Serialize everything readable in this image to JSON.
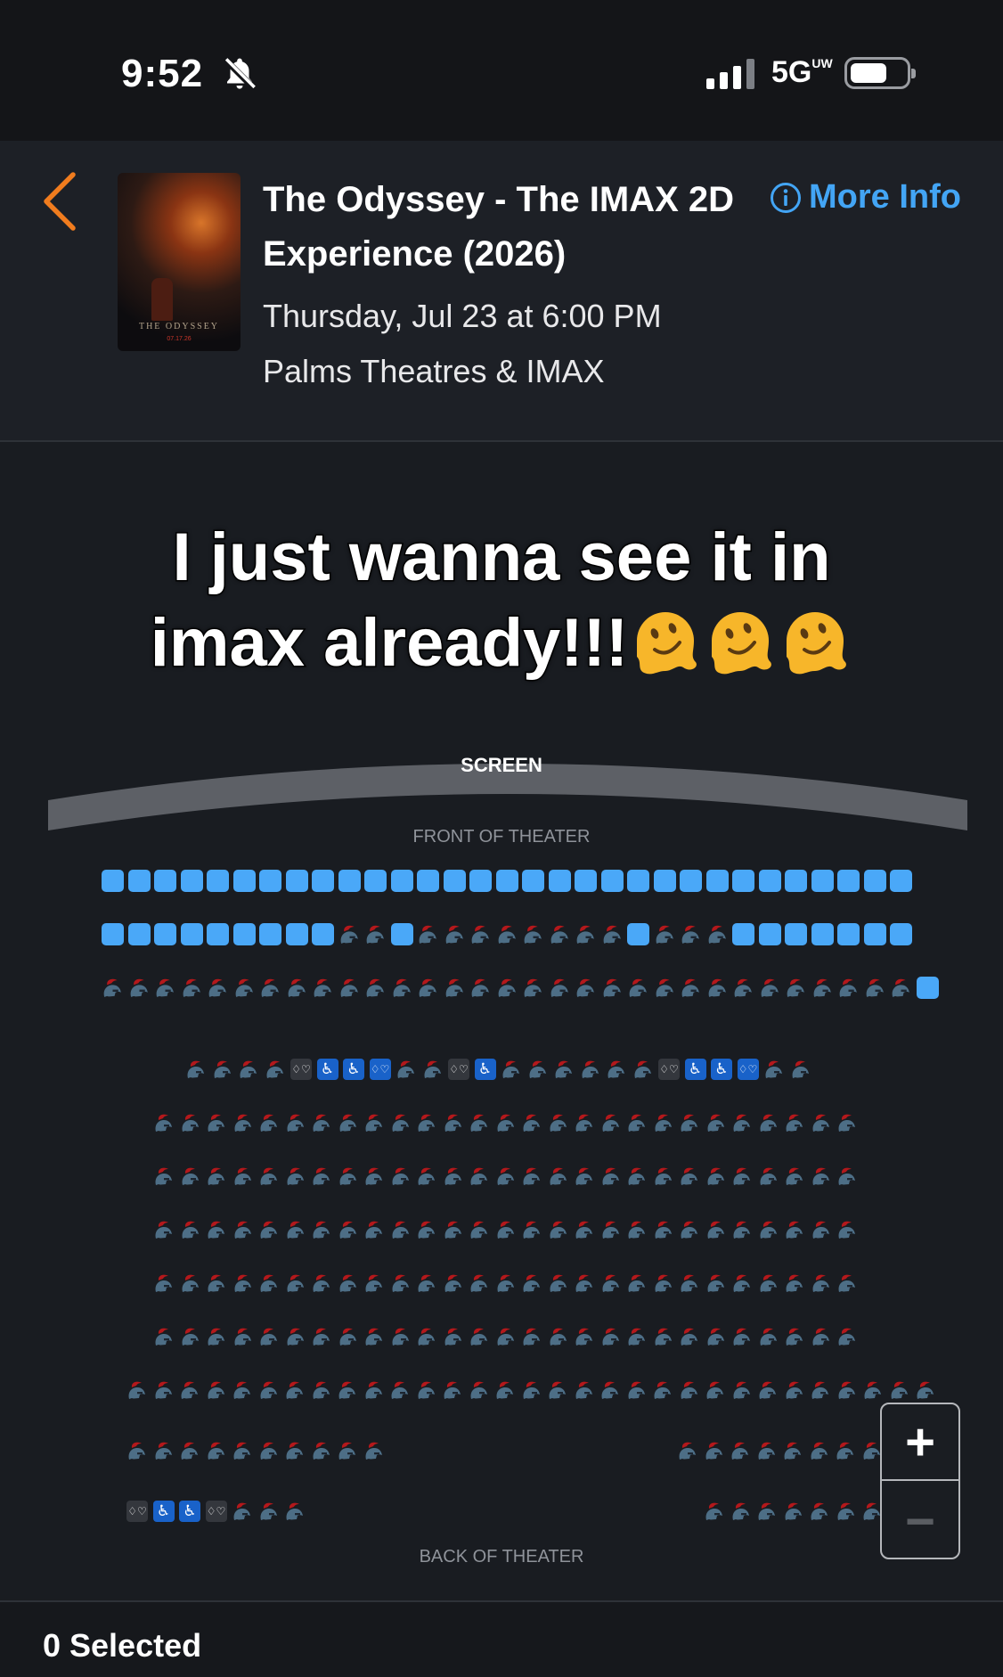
{
  "status_bar": {
    "time": "9:52",
    "network": "5G",
    "network_sup": "UW",
    "bell_icon": "bell-slash-icon"
  },
  "header": {
    "back_icon": "chevron-left-icon",
    "movie_title": "The Odyssey - The IMAX 2D Experience (2026)",
    "showtime": "Thursday, Jul 23 at 6:00 PM",
    "theatre": "Palms Theatres & IMAX",
    "more_info": "More Info",
    "poster": {
      "title": "THE ODYSSEY",
      "date": "07.17.26"
    }
  },
  "caption": {
    "line1": "I just wanna see it in",
    "line2": "imax already!!!",
    "emoji": "melting-face-icon",
    "emoji_count": 3
  },
  "seat_map": {
    "screen_label": "SCREEN",
    "front_label": "FRONT OF THEATER",
    "back_label": "BACK OF THEATER",
    "legend": {
      "a": "available",
      "t": "taken",
      "w": "wheelchair",
      "c": "companion",
      "C": "companion-accessible"
    },
    "rows": [
      "aaaaaaaaaaaaaaaaaaaaaaaaaaaaaaa",
      "aaaaaaaaattattttttttatttaaaaaaa",
      "ttttttttttttttttttttttttttttttta",
      "ttttcwwCttcwttttttcwwCtt",
      "ttttttttttttttttttttttttttt",
      "ttttttttttttttttttttttttttt",
      "ttttttttttttttttttttttttttt",
      "ttttttttttttttttttttttttttt",
      "ttttttttttttttttttttttttttt",
      "ttttttttttttttttttttttttttttttt",
      "tttttttttt|ttttttttt",
      "cwwcttt|ttttttt"
    ],
    "zoom_in": "+",
    "zoom_out": "−",
    "colors": {
      "available": "#4aa8f8",
      "wheelchair": "#1962c9",
      "companion": "#34373d",
      "helmet_plume": "#b4181b",
      "helmet_body": "#4d6e86"
    }
  },
  "footer": {
    "selected_label": "0 Selected"
  }
}
